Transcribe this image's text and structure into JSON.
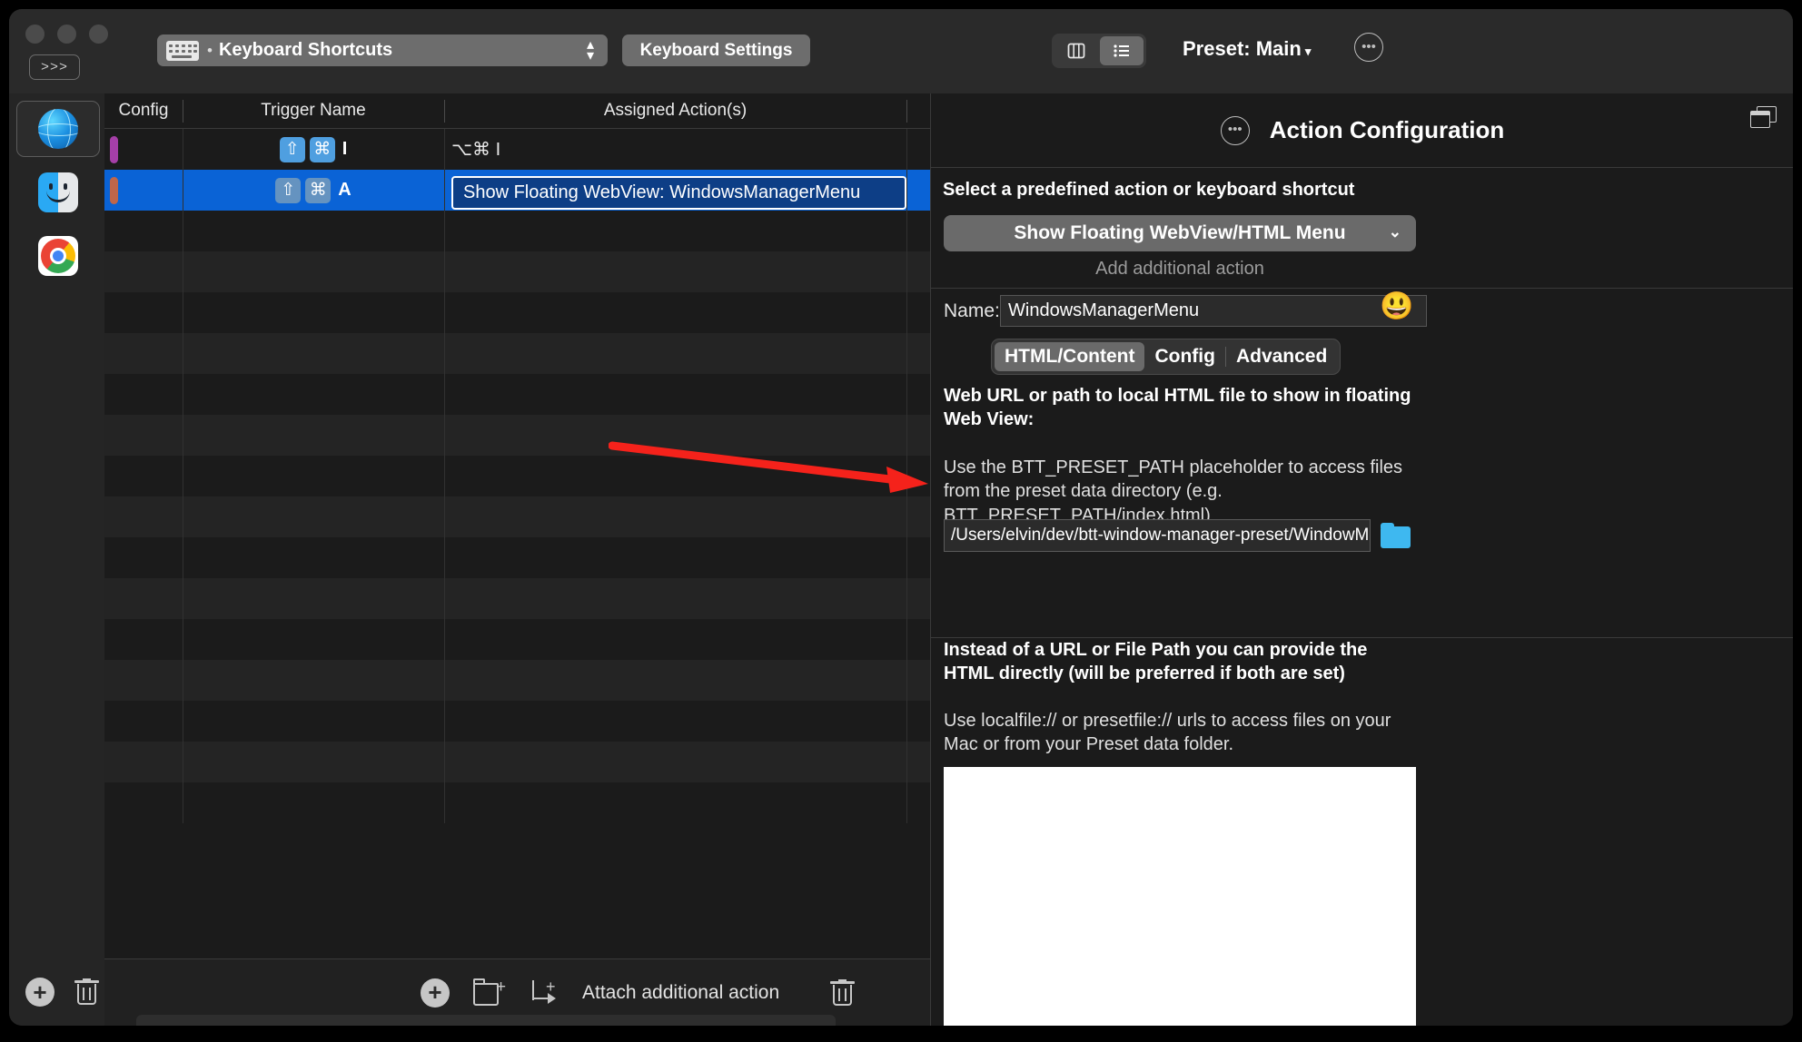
{
  "window": {
    "traffic_lights": [
      "close",
      "minimize",
      "zoom"
    ],
    "prompt_button": ">>>"
  },
  "toolbar": {
    "popup_icon": "keyboard-icon",
    "popup_bullet": "•",
    "popup_label": "Keyboard Shortcuts",
    "stepper_glyph": "⌃⌄",
    "settings_button": "Keyboard Settings",
    "view_segments": [
      {
        "name": "columns-view",
        "active": false
      },
      {
        "name": "list-view",
        "active": true
      }
    ],
    "preset_label": "Preset: Main",
    "preset_caret": "▾",
    "more_button": "•••"
  },
  "sidebar": {
    "items": [
      {
        "name": "globe-app",
        "icon": "globe-icon",
        "selected": true
      },
      {
        "name": "finder-app",
        "icon": "finder-icon",
        "selected": false
      },
      {
        "name": "chrome-app",
        "icon": "chrome-icon",
        "selected": false
      }
    ],
    "add_button": "+",
    "delete_button": "trash-icon"
  },
  "table": {
    "columns": [
      "Config",
      "Trigger Name",
      "Assigned Action(s)",
      ""
    ],
    "rows": [
      {
        "config_color": "#a53fa8",
        "trigger_keys": [
          "⇧",
          "⌘"
        ],
        "trigger_letter": "I",
        "action": "⌥⌘ I",
        "selected": false,
        "boxed": false
      },
      {
        "config_color": "#c0664a",
        "trigger_keys": [
          "⇧",
          "⌘"
        ],
        "trigger_letter": "A",
        "action": "Show Floating WebView: WindowsManagerMenu",
        "selected": true,
        "boxed": true
      }
    ],
    "empty_row_count": 15,
    "footer": {
      "add_button": "+",
      "new_folder_button": "new-folder-icon",
      "attach_label": "Attach additional action",
      "delete_button": "trash-icon"
    }
  },
  "panel": {
    "header_more": "•••",
    "title": "Action Configuration",
    "detach_icon": "windows-icon",
    "select_action_label": "Select a predefined action or keyboard shortcut",
    "action_dropdown": "Show Floating WebView/HTML Menu",
    "dropdown_chevron": "⌄",
    "add_additional_action": "Add additional action",
    "name_label": "Name:",
    "name_value": "WindowsManagerMenu",
    "emoji_button": "😃",
    "tabs": [
      {
        "label": "HTML/Content",
        "active": true
      },
      {
        "label": "Config",
        "active": false
      },
      {
        "label": "Advanced",
        "active": false
      }
    ],
    "web_url_heading": "Web URL or path to local HTML file to show in floating Web View:",
    "preset_path_hint": "Use the BTT_PRESET_PATH placeholder to access files from the preset data directory (e.g. BTT_PRESET_PATH/index.html)",
    "path_value": "/Users/elvin/dev/btt-window-manager-preset/WindowM",
    "browse_icon": "folder-icon",
    "html_direct_heading": "Instead of a URL or File Path you can provide the HTML directly (will be preferred if both are set)",
    "localfile_hint": "Use localfile:// or presetfile:// urls to access files on your Mac or from your Preset data folder.",
    "html_editor_value": ""
  },
  "annotation": {
    "arrow_color": "#f5221b",
    "name": "red-pointer-arrow"
  },
  "colors": {
    "selection_blue": "#0a63d6",
    "boxed_blue": "#0d3e86",
    "panel_bg": "#1b1b1b",
    "titlebar_bg": "#2a2a2a"
  }
}
